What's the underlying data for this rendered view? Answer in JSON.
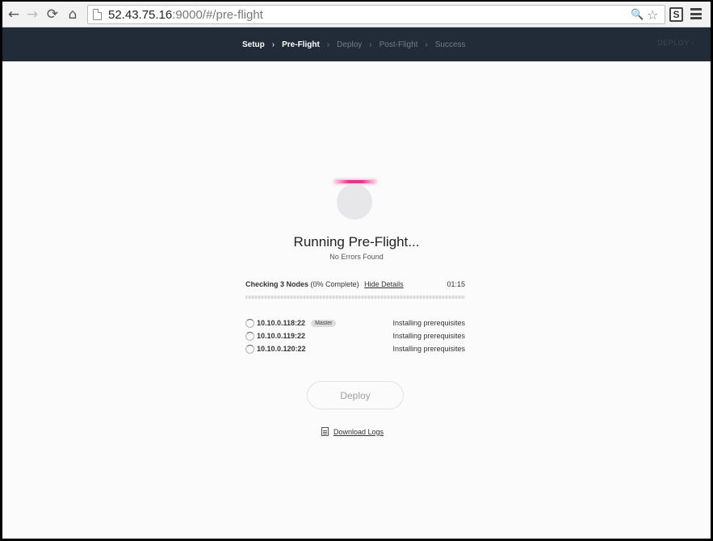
{
  "browser": {
    "url_host": "52.43.75.16",
    "url_port": ":9000",
    "url_path": "/#/pre-flight",
    "back_icon": "←",
    "forward_icon": "→",
    "reload_icon": "⟳",
    "home_icon": "⌂",
    "search_icon": "🔍",
    "star_icon": "☆",
    "extension_label": "S"
  },
  "header": {
    "steps": [
      {
        "label": "Setup",
        "state": "done"
      },
      {
        "label": "Pre-Flight",
        "state": "current"
      },
      {
        "label": "Deploy",
        "state": "pending"
      },
      {
        "label": "Post-Flight",
        "state": "pending"
      },
      {
        "label": "Success",
        "state": "pending"
      }
    ],
    "separator": "›",
    "deploy_label": "DEPLOY  ›"
  },
  "main": {
    "title": "Running Pre-Flight...",
    "subtitle": "No Errors Found",
    "progress_label": "Checking 3 Nodes",
    "progress_percent_text": "(0% Complete)",
    "progress_value": 0,
    "details_link": "Hide Details",
    "elapsed_time": "01:15",
    "nodes": [
      {
        "host": "10.10.0.118:22",
        "badge": "Master",
        "status": "Installing prerequisites"
      },
      {
        "host": "10.10.0.119:22",
        "badge": "",
        "status": "Installing prerequisites"
      },
      {
        "host": "10.10.0.120:22",
        "badge": "",
        "status": "Installing prerequisites"
      }
    ],
    "deploy_button": "Deploy",
    "download_logs": "Download Logs"
  },
  "colors": {
    "header_bg": "#222b38",
    "accent": "#e8328c"
  }
}
